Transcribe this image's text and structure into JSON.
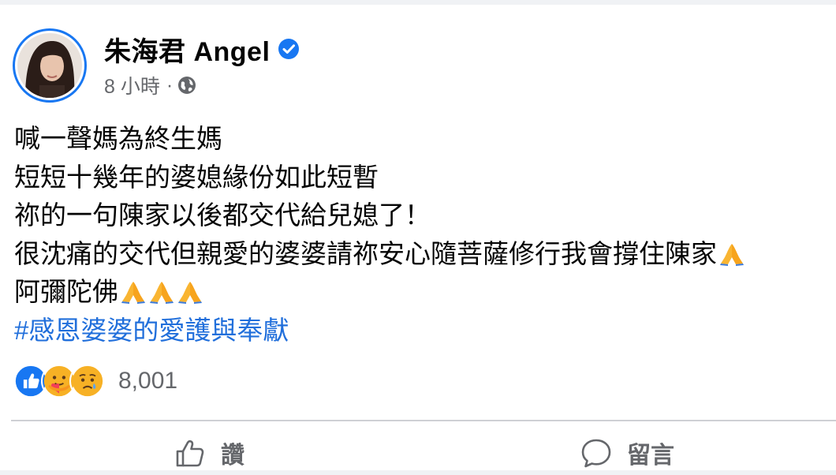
{
  "post": {
    "author": "朱海君 Angel",
    "timestamp": "8 小時",
    "separator": "·",
    "privacy_icon": "globe-icon",
    "verified_icon": "verified-badge-icon",
    "lines": [
      "喊一聲媽為終生媽",
      "短短十幾年的婆媳緣份如此短暫",
      "祢的一句陳家以後都交代給兒媳了！",
      "很沈痛的交代但親愛的婆婆請祢安心隨菩薩修行我會撐住陳家",
      "阿彌陀佛"
    ],
    "line4_emoji": "folded-hands-emoji",
    "line5_emojis": [
      "folded-hands-emoji",
      "folded-hands-emoji",
      "folded-hands-emoji"
    ],
    "hashtag": "#感恩婆婆的愛護與奉獻"
  },
  "reactions": {
    "icons": [
      "like-reaction-icon",
      "care-reaction-icon",
      "sad-reaction-icon"
    ],
    "count": "8,001"
  },
  "actions": {
    "like_label": "讚",
    "comment_label": "留言"
  },
  "colors": {
    "accent": "#1877f2",
    "hashtag": "#216fdb",
    "secondary_text": "#65676b"
  }
}
